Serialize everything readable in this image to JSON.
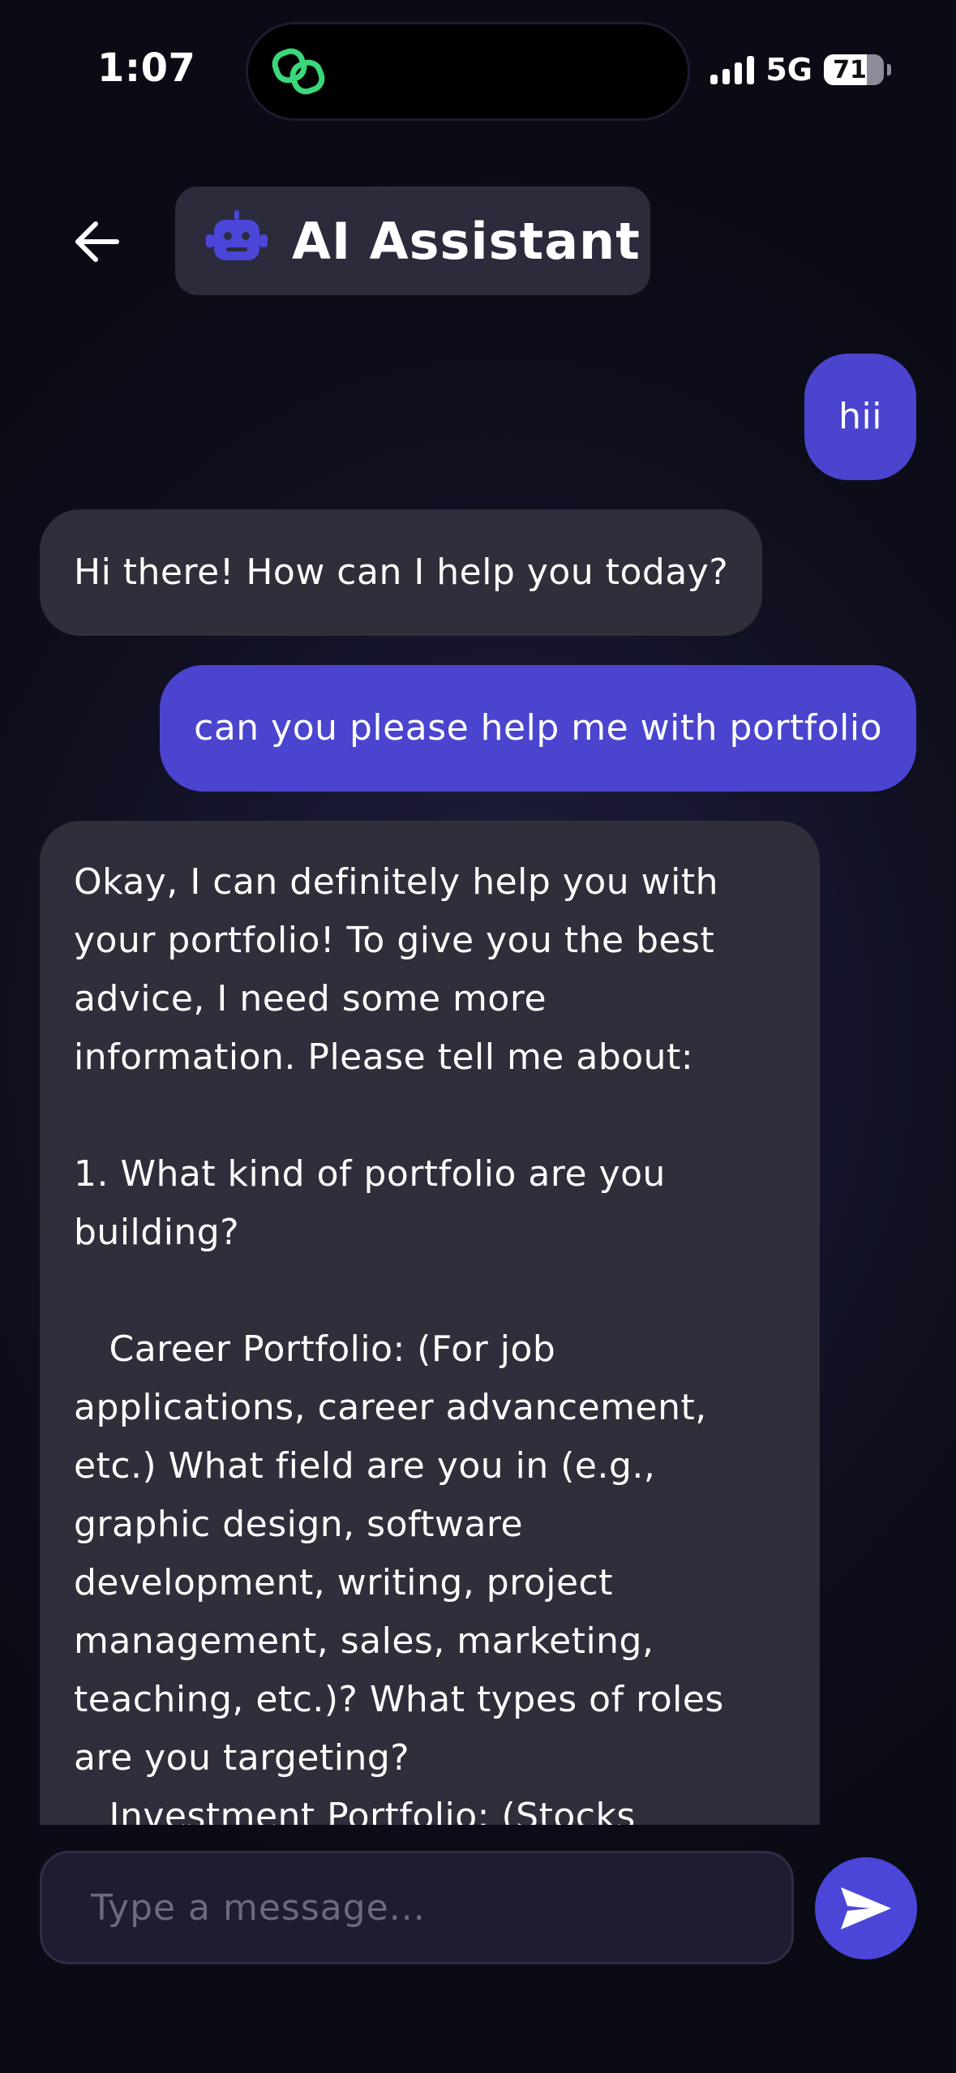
{
  "status_bar": {
    "time": "1:07",
    "network": "5G",
    "battery": "71",
    "battery_level": 0.71,
    "island_icon": "link-icon"
  },
  "header": {
    "back_icon": "back-arrow-icon",
    "bot_icon": "robot-icon",
    "title": "AI Assistant"
  },
  "messages": [
    {
      "role": "user",
      "text": "hii"
    },
    {
      "role": "assistant",
      "text": "Hi there! How can I help you today?"
    },
    {
      "role": "user",
      "text": "can you please help me with portfolio"
    },
    {
      "role": "assistant",
      "text": "Okay, I can definitely help you with\nyour portfolio! To give you the best\nadvice, I need some more\ninformation. Please tell me about:\n\n1. What kind of portfolio are you\nbuilding?\n\n   Career Portfolio: (For job\napplications, career advancement,\netc.) What field are you in (e.g.,\ngraphic design, software\ndevelopment, writing, project\nmanagement, sales, marketing,\nteaching, etc.)? What types of roles\nare you targeting?\n   Investment Portfolio: (Stocks"
    }
  ],
  "composer": {
    "placeholder": "Type a message...",
    "value": "",
    "send_icon": "send-icon"
  },
  "colors": {
    "user_bubble": "#4a44cf",
    "assistant_bubble": "#2f2e3a",
    "accent": "#4b46d8",
    "island_icon": "#39d87a"
  }
}
